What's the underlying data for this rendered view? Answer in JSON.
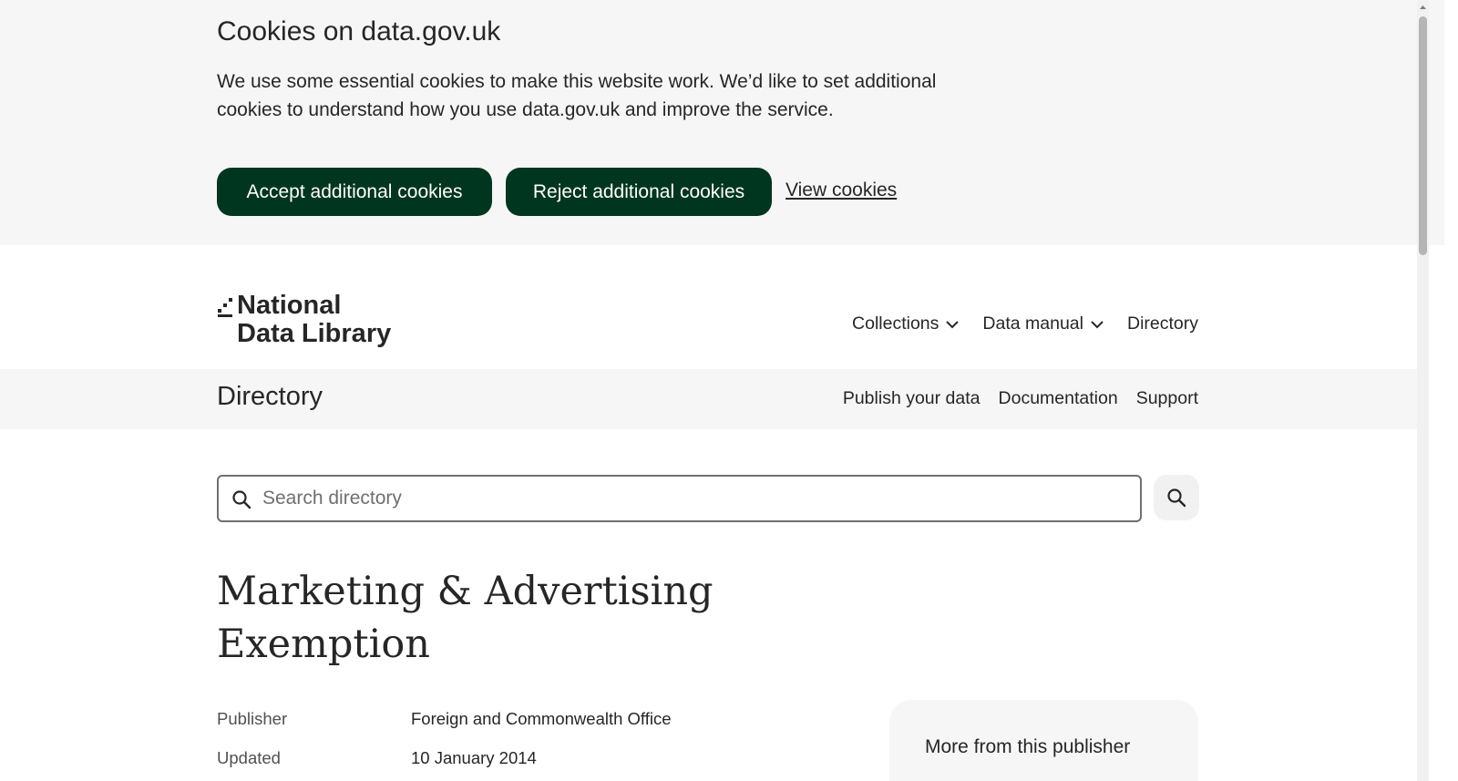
{
  "cookie_banner": {
    "title": "Cookies on data.gov.uk",
    "text": "We use some essential cookies to make this website work. We’d like to set additional cookies to understand how you use data.gov.uk and improve the service.",
    "accept_label": "Accept additional cookies",
    "reject_label": "Reject additional cookies",
    "view_label": "View cookies"
  },
  "header": {
    "logo_line1": "National",
    "logo_line2": "Data Library",
    "nav": [
      {
        "label": "Collections",
        "icon": "chevron-down-icon"
      },
      {
        "label": "Data manual",
        "icon": "chevron-down-icon"
      },
      {
        "label": "Directory"
      }
    ]
  },
  "subheader": {
    "title": "Directory",
    "links": [
      "Publish your data",
      "Documentation",
      "Support"
    ]
  },
  "search": {
    "placeholder": "Search directory",
    "icon": "search-icon"
  },
  "dataset": {
    "title": "Marketing & Advertising Exemption",
    "meta": [
      {
        "label": "Publisher",
        "value": "Foreign and Commonwealth Office"
      },
      {
        "label": "Updated",
        "value": "10 January 2014"
      }
    ]
  },
  "sidebar": {
    "card_title": "More from this publisher"
  },
  "colors": {
    "button_bg": "#00361f",
    "banner_bg": "#f6f6f6",
    "text": "#262626"
  }
}
